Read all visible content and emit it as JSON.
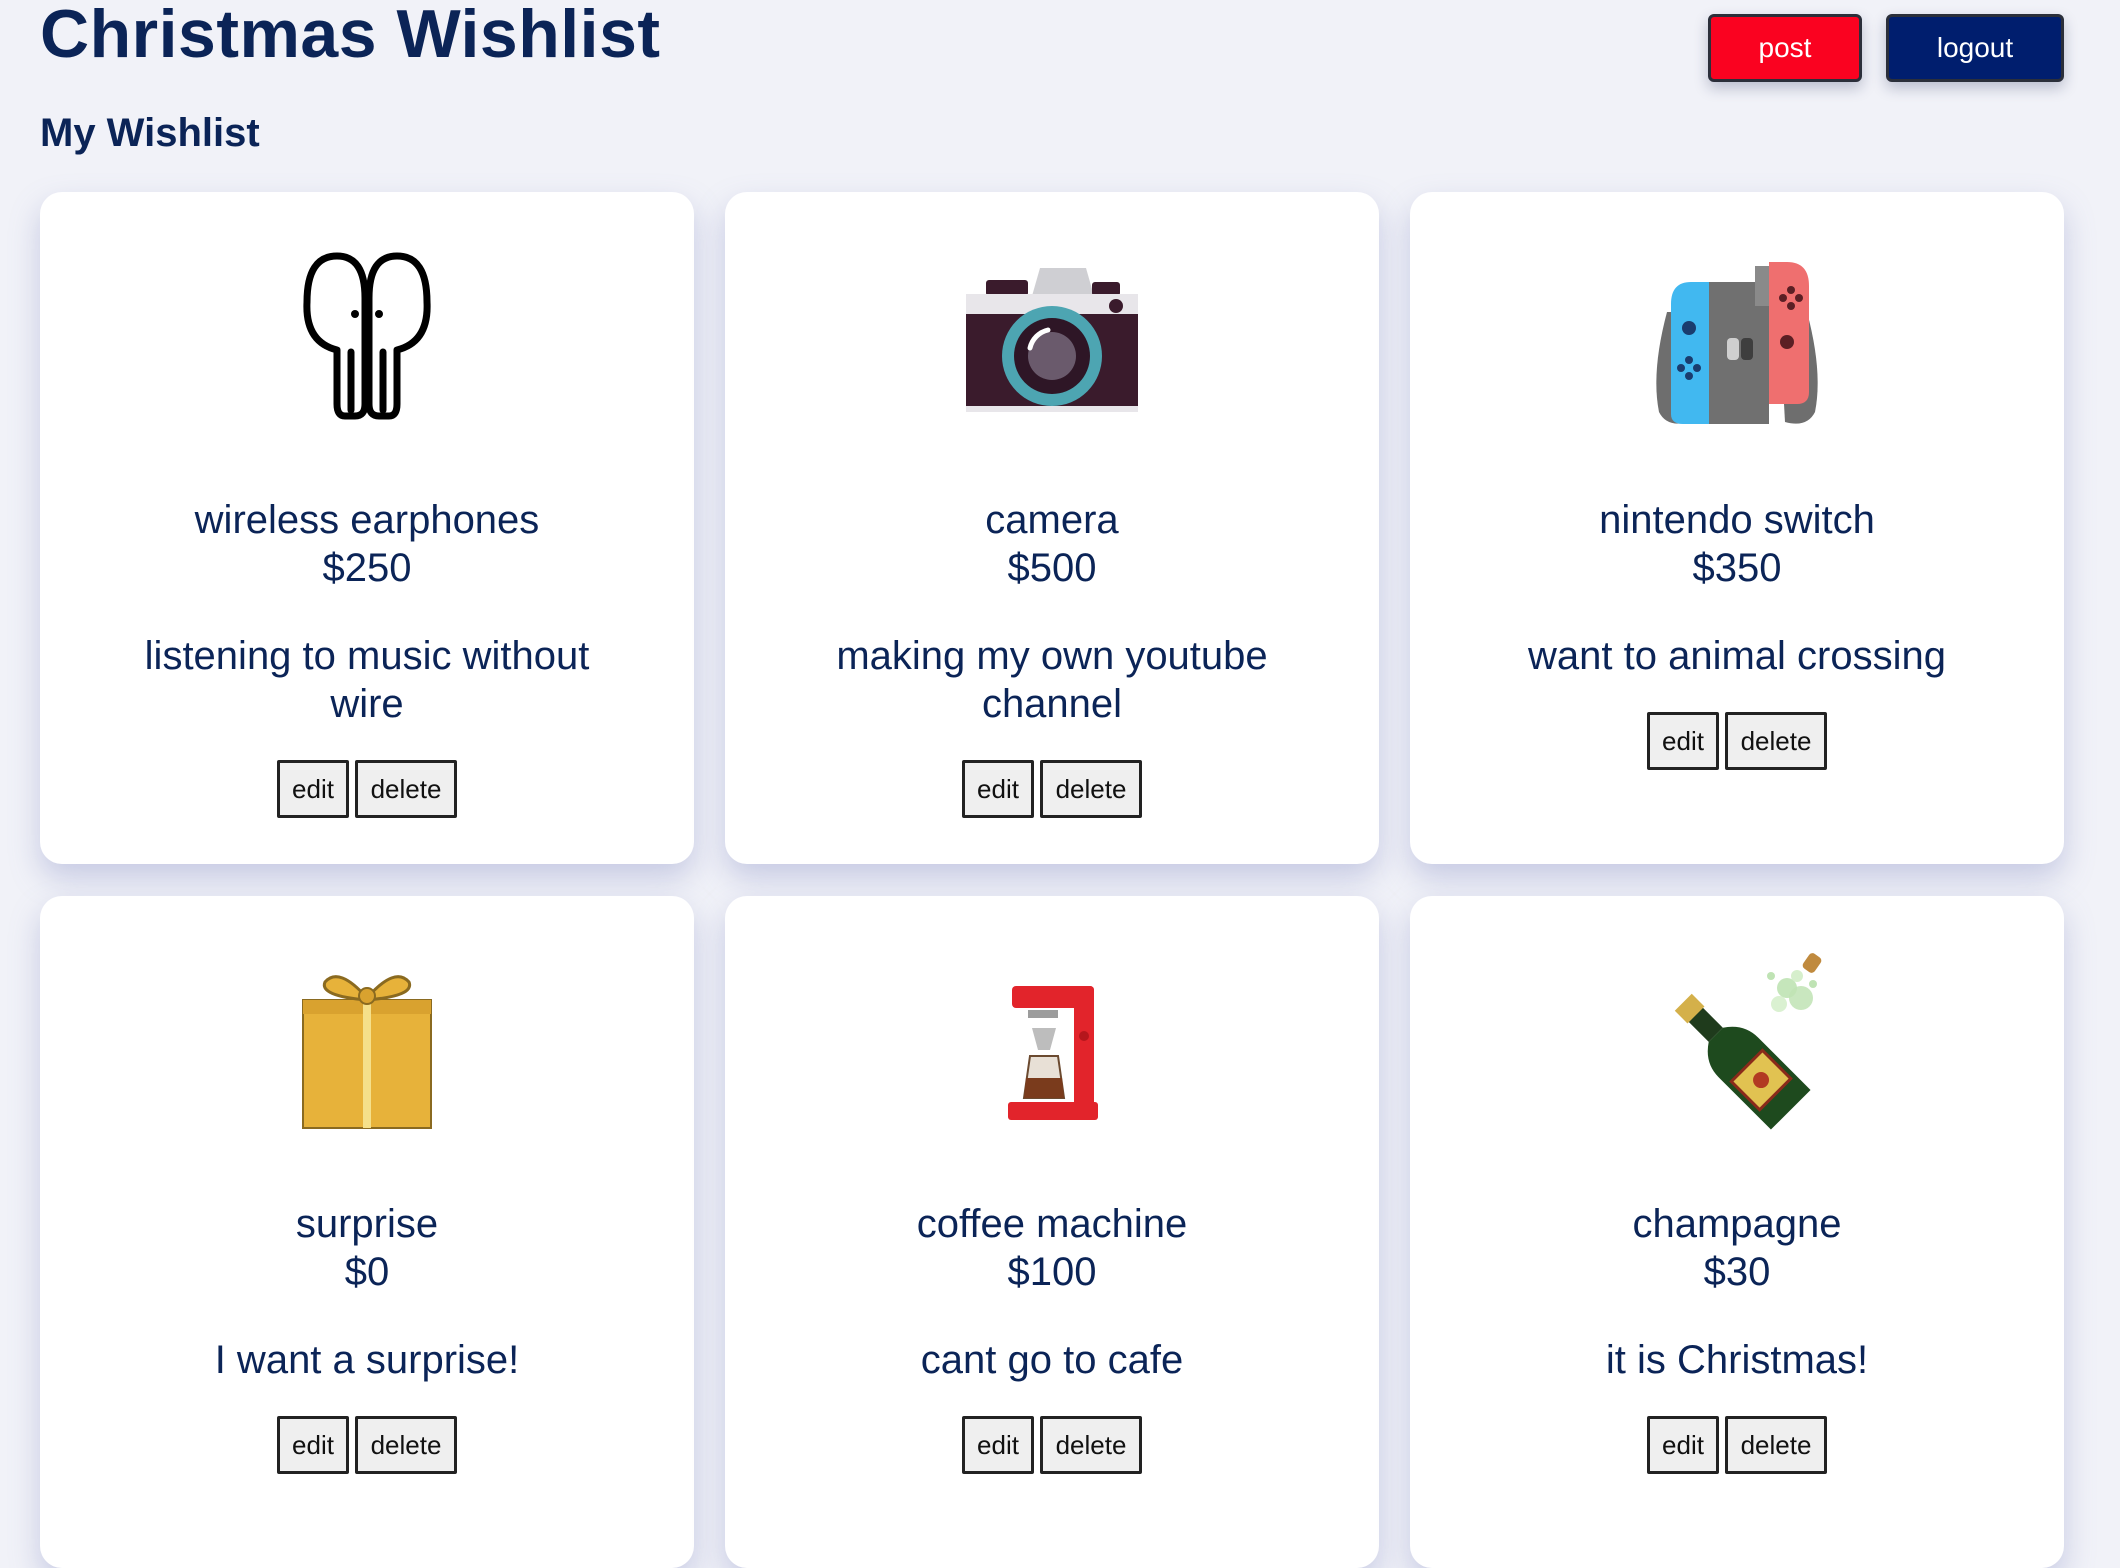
{
  "header": {
    "title": "Christmas Wishlist",
    "post_label": "post",
    "logout_label": "logout"
  },
  "section_title": "My Wishlist",
  "items": [
    {
      "name": "wireless earphones",
      "price": "$250",
      "description": "listening to music without wire",
      "icon": "earphones-icon"
    },
    {
      "name": "camera",
      "price": "$500",
      "description": "making my own youtube channel",
      "icon": "camera-icon"
    },
    {
      "name": "nintendo switch",
      "price": "$350",
      "description": "want to animal crossing",
      "icon": "game-console-icon"
    },
    {
      "name": "surprise",
      "price": "$0",
      "description": "I want a surprise!",
      "icon": "gift-icon"
    },
    {
      "name": "coffee machine",
      "price": "$100",
      "description": "cant go to cafe",
      "icon": "coffee-machine-icon"
    },
    {
      "name": "champagne",
      "price": "$30",
      "description": "it is Christmas!",
      "icon": "champagne-icon"
    }
  ],
  "actions": {
    "edit_label": "edit",
    "delete_label": "delete"
  },
  "colors": {
    "background": "#f1f2f8",
    "text": "#0b2457",
    "post_button": "#fa0220",
    "logout_button": "#001e6e"
  }
}
